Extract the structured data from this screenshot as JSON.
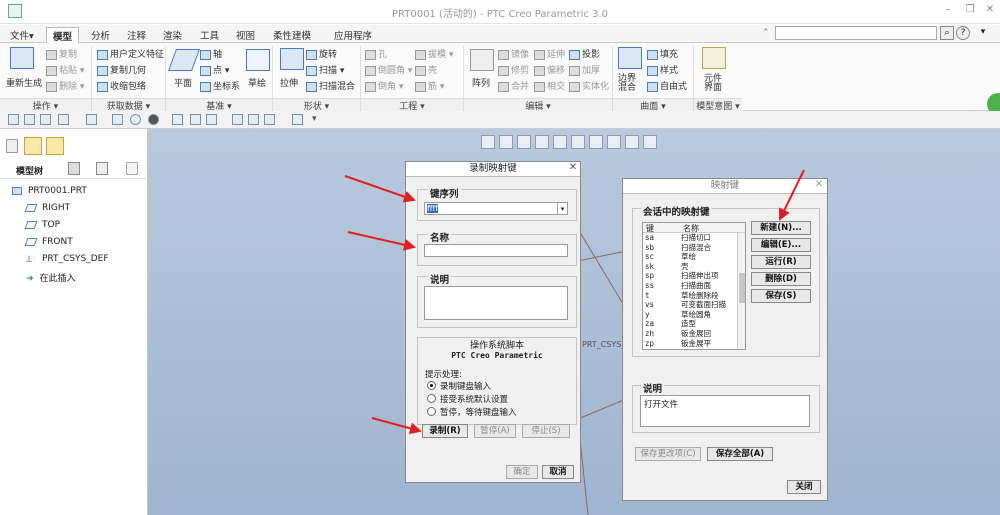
{
  "window": {
    "title": "PRT0001 (活动的) - PTC Creo Parametric 3.0"
  },
  "tabs": [
    "文件▾",
    "模型",
    "分析",
    "注释",
    "渲染",
    "工具",
    "视图",
    "柔性建模",
    "应用程序"
  ],
  "ribbon": {
    "regen": "重新生成",
    "copy": "复制",
    "paste": "粘贴",
    "delete": "删除",
    "udf": "用户定义特征",
    "copy_geom": "复制几何",
    "shrinkwrap": "收缩包络",
    "plane": "平面",
    "axis": "轴",
    "point": "点",
    "csys": "坐标系",
    "sketch": "草绘",
    "extrude": "拉伸",
    "revolve": "旋转",
    "sweep": "扫描",
    "swept_blend": "扫描混合",
    "hole": "孔",
    "draft": "拔模",
    "round": "倒圆角",
    "shell": "壳",
    "chamfer": "倒角",
    "rib": "筋",
    "pattern": "阵列",
    "mirror": "镜像",
    "trim": "修剪",
    "merge": "合并",
    "extend": "延伸",
    "offset": "偏移",
    "intersect": "相交",
    "project": "投影",
    "thicken": "加厚",
    "solidify": "实体化",
    "boundary_blend": "边界混合",
    "fill": "填充",
    "style": "样式",
    "freestyle": "自由式",
    "component_interface": "元件界面",
    "groups": [
      "操作 ▾",
      "获取数据 ▾",
      "基准 ▾",
      "形状 ▾",
      "工程 ▾",
      "编辑 ▾",
      "曲面 ▾",
      "模型意图 ▾"
    ]
  },
  "tree": {
    "tab": "模型树",
    "items": [
      "PRT0001.PRT",
      "RIGHT",
      "TOP",
      "FRONT",
      "PRT_CSYS_DEF",
      "在此插入"
    ]
  },
  "canvas": {
    "csys_label": "PRT_CSYS_"
  },
  "record_dialog": {
    "title": "录制映射键",
    "key_sequence_label": "键序列",
    "key_sequence_value": "ffff",
    "name_label": "名称",
    "desc_label": "说明",
    "os_script_label": "操作系统脚本",
    "app_name": "PTC Creo Parametric",
    "prompt_label": "提示处理:",
    "options": [
      "录制键盘输入",
      "接受系统默认设置",
      "暂停，等待键盘输入"
    ],
    "record_btn": "录制(R)",
    "pause_btn": "暂停(A)",
    "stop_btn": "停止(S)",
    "ok_btn": "确定",
    "cancel_btn": "取消"
  },
  "mapkeys_dialog": {
    "title": "映射键",
    "list_label": "会话中的映射键",
    "col_key": "键",
    "col_name": "名称",
    "rows": [
      [
        "sa",
        "扫描切口"
      ],
      [
        "sb",
        "扫描混合"
      ],
      [
        "sc",
        "草绘"
      ],
      [
        "sk",
        "壳"
      ],
      [
        "sp",
        "扫描伸出项"
      ],
      [
        "ss",
        "扫描曲面"
      ],
      [
        "t",
        "草绘删除段"
      ],
      [
        "vs",
        "可变截面扫描"
      ],
      [
        "y",
        "草绘圆角"
      ],
      [
        "za",
        "造型"
      ],
      [
        "zh",
        "钣金展回"
      ],
      [
        "zp",
        "钣金展平"
      ]
    ],
    "new_btn": "新建(N)...",
    "edit_btn": "编辑(E)...",
    "run_btn": "运行(R)",
    "delete_btn": "删除(D)",
    "save_btn": "保存(S)",
    "desc_label": "说明",
    "desc_value": "打开文件",
    "save_changed_btn": "保存更改项(C)",
    "save_all_btn": "保存全部(A)",
    "close_btn": "关闭"
  },
  "colors": {
    "canvas_top": "#b9c9de",
    "canvas_bottom": "#9fb4d0",
    "arrow": "#e02020",
    "accent_green": "#4cb34c"
  }
}
